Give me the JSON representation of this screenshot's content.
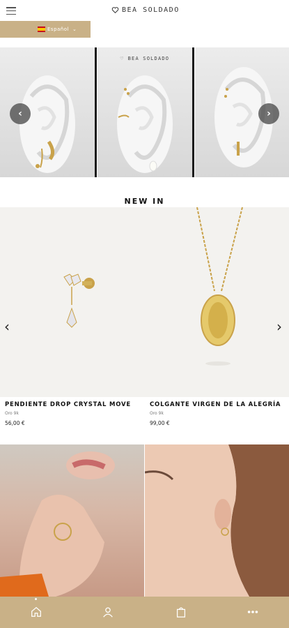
{
  "header": {
    "brand": "BEA SOLDADO",
    "menu_icon": "menu-icon",
    "heart_icon": "heart-icon"
  },
  "language": {
    "label": "Español",
    "flag": "spain-flag-icon",
    "caret": "⌄"
  },
  "carousel": {
    "panel_brand": "BEA SOLDADO",
    "prev_icon": "chevron-left-icon",
    "next_icon": "chevron-right-icon"
  },
  "new_in": {
    "title": "NEW IN",
    "products": [
      {
        "name": "PENDIENTE DROP CRYSTAL MOVE",
        "material": "Oro 9k",
        "price": "56,00 €"
      },
      {
        "name": "COLGANTE VIRGEN DE LA ALEGRÍA",
        "material": "Oro 9k",
        "price": "99,00 €"
      }
    ]
  },
  "colors": {
    "gold_accent": "#c9b187",
    "background": "#ffffff"
  },
  "tabbar": {
    "items": [
      "home-icon",
      "user-icon",
      "bag-icon",
      "more-icon"
    ],
    "active": 0
  }
}
